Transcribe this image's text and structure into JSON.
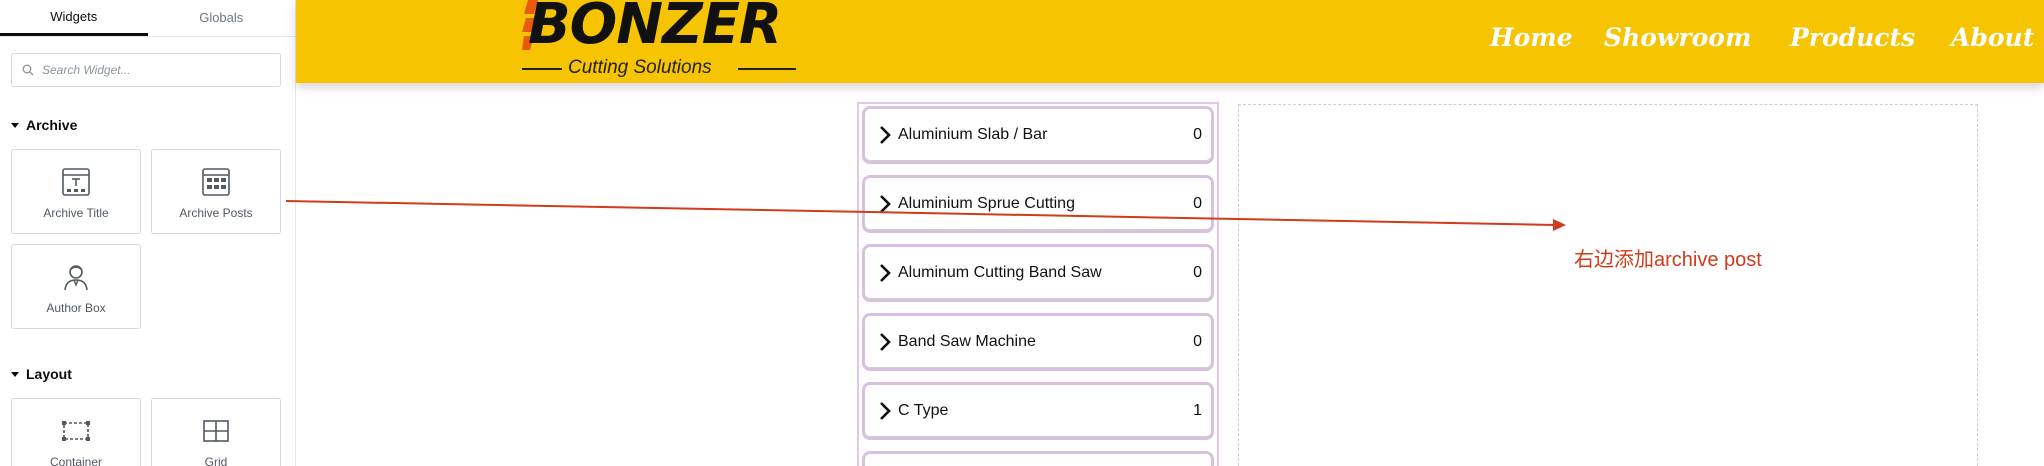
{
  "panel": {
    "tabs": [
      {
        "label": "Widgets",
        "active": true
      },
      {
        "label": "Globals",
        "active": false
      }
    ],
    "search": {
      "placeholder": "Search Widget..."
    },
    "sections": [
      {
        "title": "Archive",
        "widgets": [
          {
            "label": "Archive Title",
            "icon": "archive-title-icon"
          },
          {
            "label": "Archive Posts",
            "icon": "archive-posts-icon"
          },
          {
            "label": "Author Box",
            "icon": "author-box-icon"
          }
        ]
      },
      {
        "title": "Layout",
        "widgets": [
          {
            "label": "Container",
            "icon": "container-icon"
          },
          {
            "label": "Grid",
            "icon": "grid-icon"
          }
        ]
      }
    ]
  },
  "header": {
    "logo": {
      "word": "BONZER",
      "tagline": "Cutting Solutions"
    },
    "nav": [
      "Home",
      "Showroom",
      "Products",
      "About"
    ],
    "bg_color": "#f6c400"
  },
  "categories": [
    {
      "name": "Aluminium Slab / Bar",
      "count": "0"
    },
    {
      "name": "Aluminium Sprue Cutting",
      "count": "0"
    },
    {
      "name": "Aluminum Cutting Band Saw",
      "count": "0"
    },
    {
      "name": "Band Saw Machine",
      "count": "0"
    },
    {
      "name": "C Type",
      "count": "1"
    }
  ],
  "annotation": {
    "text": "右边添加archive post",
    "color": "#d13a1a"
  }
}
